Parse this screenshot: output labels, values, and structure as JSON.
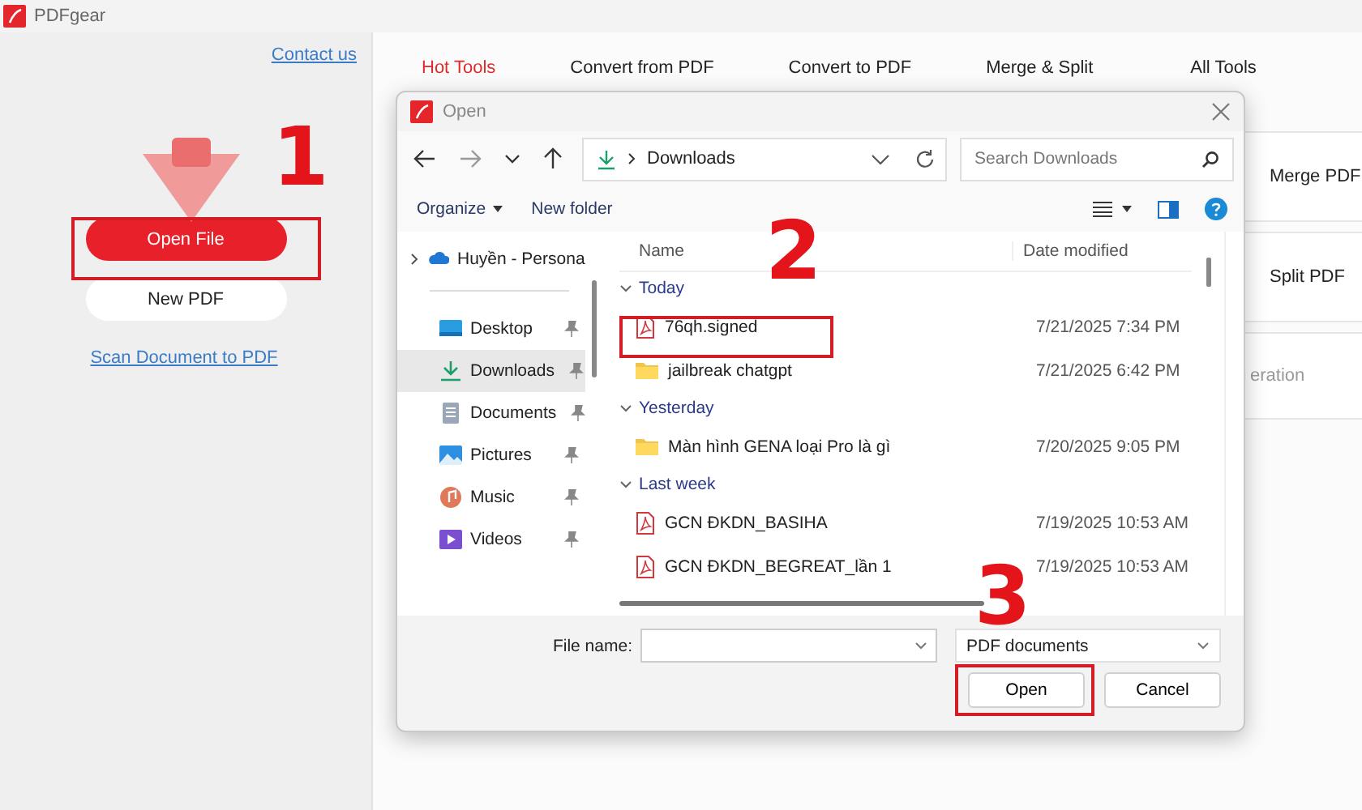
{
  "app": {
    "title": "PDFgear",
    "contact_link": "Contact us",
    "open_button": "Open File",
    "new_button": "New PDF",
    "scan_link": "Scan Document to PDF"
  },
  "tabs": [
    {
      "label": "Hot Tools",
      "selected": true
    },
    {
      "label": "Convert from PDF",
      "selected": false
    },
    {
      "label": "Convert to PDF",
      "selected": false
    },
    {
      "label": "Merge & Split",
      "selected": false
    },
    {
      "label": "All Tools",
      "selected": false
    }
  ],
  "tool_cards": [
    "Merge PDF",
    "Split PDF",
    "eration"
  ],
  "dialog": {
    "title": "Open",
    "path": "Downloads",
    "search": {
      "placeholder": "Search Downloads"
    },
    "organize": "Organize",
    "new_folder": "New folder",
    "sidebar": [
      {
        "label": "Huyền - Persona",
        "kind": "cloud",
        "selected": false
      },
      {
        "label": "Desktop",
        "kind": "desktop",
        "selected": false
      },
      {
        "label": "Downloads",
        "kind": "download",
        "selected": true
      },
      {
        "label": "Documents",
        "kind": "documents",
        "selected": false
      },
      {
        "label": "Pictures",
        "kind": "pictures",
        "selected": false
      },
      {
        "label": "Music",
        "kind": "music",
        "selected": false
      },
      {
        "label": "Videos",
        "kind": "videos",
        "selected": false
      }
    ],
    "columns": [
      "Name",
      "Date modified"
    ],
    "groups": [
      {
        "label": "Today",
        "expanded": true,
        "files": [
          {
            "name": "76qh.signed",
            "date": "7/21/2025 7:34 PM",
            "kind": "pdf"
          },
          {
            "name": "jailbreak chatgpt",
            "date": "7/21/2025 6:42 PM",
            "kind": "folder"
          }
        ]
      },
      {
        "label": "Yesterday",
        "expanded": true,
        "files": [
          {
            "name": "Màn hình GENA loại Pro là gì",
            "date": "7/20/2025 9:05 PM",
            "kind": "folder"
          }
        ]
      },
      {
        "label": "Last week",
        "expanded": true,
        "files": [
          {
            "name": "GCN ĐKDN_BASIHA",
            "date": "7/19/2025 10:53 AM",
            "kind": "pdf"
          },
          {
            "name": "GCN ĐKDN_BEGREAT_lần 1",
            "date": "7/19/2025 10:53 AM",
            "kind": "pdf"
          }
        ]
      }
    ],
    "file_name_label": "File name:",
    "file_type": "PDF documents",
    "buttons": [
      "Open",
      "Cancel"
    ]
  },
  "steps": [
    "1",
    "2",
    "3"
  ]
}
